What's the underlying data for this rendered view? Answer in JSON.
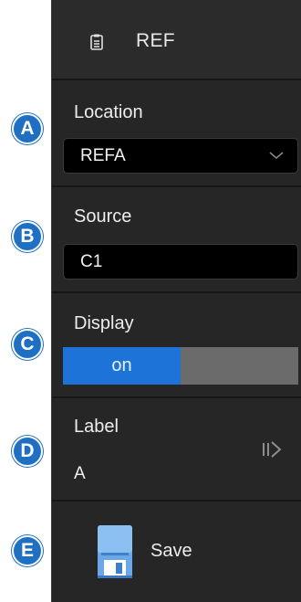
{
  "header": {
    "icon": "clipboard-list-icon",
    "title": "REF"
  },
  "location": {
    "label": "Location",
    "value": "REFA",
    "icon": "chevron-down-icon"
  },
  "source": {
    "label": "Source",
    "value": "C1"
  },
  "display": {
    "label": "Display",
    "state": "on",
    "on_color": "#1e73d8",
    "off_color": "#6b6b6b"
  },
  "label_section": {
    "label": "Label",
    "value": "A",
    "icon": "next-arrow-icon"
  },
  "save": {
    "label": "Save",
    "icon": "floppy-disk-icon"
  },
  "markers": [
    "A",
    "B",
    "C",
    "D",
    "E"
  ],
  "colors": {
    "panel_bg": "#262626",
    "marker_blue": "#1f6fc2"
  }
}
